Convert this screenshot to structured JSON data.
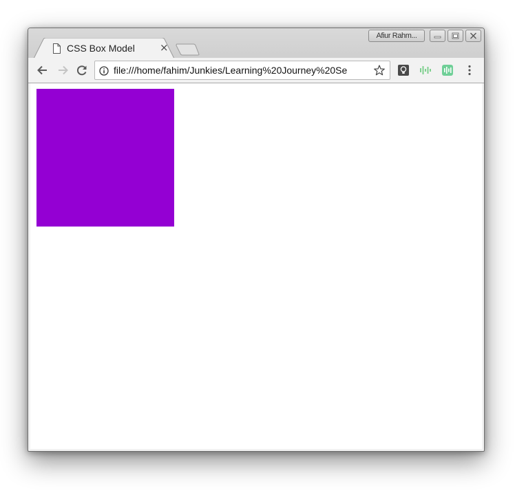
{
  "tab": {
    "title": "CSS Box Model",
    "close_glyph": "×",
    "favicon": "document-icon"
  },
  "profile": {
    "name": "Afiur Rahm..."
  },
  "window_controls": [
    "minimize",
    "maximize",
    "close"
  ],
  "toolbar": {
    "back": "arrow-left-icon",
    "forward": "arrow-right-icon",
    "reload": "reload-icon",
    "url": "file:///home/fahim/Junkies/Learning%20Journey%20Se",
    "extensions": [
      "lightbulb-icon",
      "audio-wave-icon",
      "puzzle-wave-icon"
    ],
    "menu": "kebab-menu-icon"
  },
  "colors": {
    "box": "#9400d3",
    "ext_green": "#6fcf97"
  }
}
